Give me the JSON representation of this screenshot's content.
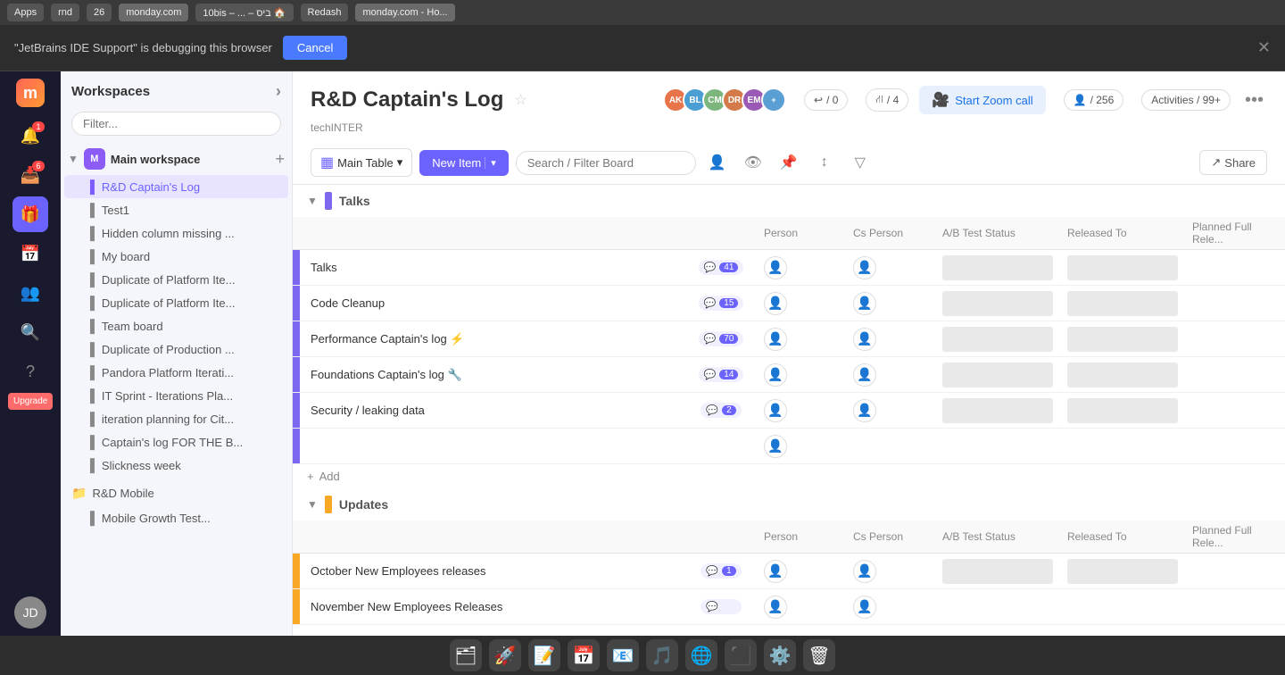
{
  "browser": {
    "tabs": [
      {
        "label": "Apps",
        "active": false
      },
      {
        "label": "rnd",
        "active": false
      },
      {
        "label": "26",
        "active": false
      },
      {
        "label": "monday.com",
        "active": false
      },
      {
        "label": "10bis – ... – ביס 🏠",
        "active": false
      },
      {
        "label": "Redash",
        "active": false
      },
      {
        "label": "monday.com - Ho...",
        "active": true
      }
    ]
  },
  "debug_bar": {
    "message": "\"JetBrains IDE Support\" is debugging this browser",
    "cancel_label": "Cancel",
    "close_icon": "✕"
  },
  "left_nav": {
    "logo": "m",
    "icons": [
      {
        "name": "bell-icon",
        "symbol": "🔔",
        "badge": "1"
      },
      {
        "name": "inbox-icon",
        "symbol": "📥",
        "badge": "6"
      },
      {
        "name": "gift-icon",
        "symbol": "🎁",
        "active": true
      },
      {
        "name": "calendar-icon",
        "symbol": "📅"
      },
      {
        "name": "people-icon",
        "symbol": "👥"
      },
      {
        "name": "search-icon",
        "symbol": "🔍"
      },
      {
        "name": "help-icon",
        "symbol": "?"
      }
    ],
    "upgrade_label": "Upgrade",
    "avatar_initials": "JD"
  },
  "sidebar": {
    "title": "Workspaces",
    "filter_placeholder": "Filter...",
    "workspace": {
      "name": "Main workspace",
      "icon": "M"
    },
    "items": [
      {
        "label": "R&D Captain's Log",
        "active": true
      },
      {
        "label": "Test1"
      },
      {
        "label": "Hidden column missing ..."
      },
      {
        "label": "My board"
      },
      {
        "label": "Duplicate of Platform Ite..."
      },
      {
        "label": "Duplicate of Platform Ite..."
      },
      {
        "label": "Team board"
      },
      {
        "label": "Duplicate of Production ..."
      },
      {
        "label": "Pandora Platform Iterati..."
      },
      {
        "label": "IT Sprint - Iterations Pla..."
      },
      {
        "label": "iteration planning for Cit..."
      },
      {
        "label": "Captain's log FOR THE B..."
      },
      {
        "label": "Slickness week"
      }
    ],
    "folder": {
      "name": "R&D Mobile"
    },
    "more_items": [
      {
        "label": "Mobile Growth Test..."
      }
    ]
  },
  "board": {
    "title": "R&D Captain's Log",
    "subtitle": "techINTER",
    "star_icon": "☆",
    "avatars": [
      {
        "color": "#e8744a",
        "initials": "AK"
      },
      {
        "color": "#4a9ed4",
        "initials": "BL"
      },
      {
        "color": "#7cb67c",
        "initials": "CM"
      },
      {
        "color": "#d47a4a",
        "initials": "DR"
      },
      {
        "color": "#9b59b6",
        "initials": "EM"
      }
    ],
    "stats": {
      "updates_count": "0",
      "members_count": "4",
      "activities_count": "99+",
      "person_count": "256"
    },
    "zoom_btn_label": "Start Zoom call",
    "more_icon": "•••",
    "table_name": "Main Table",
    "new_item_label": "New Item",
    "search_placeholder": "Search / Filter Board",
    "share_label": "Share",
    "columns": [
      "Person",
      "Cs Person",
      "A/B Test Status",
      "Released To",
      "Planned Full Rele..."
    ]
  },
  "groups": [
    {
      "name": "Talks",
      "color": "#7b68ee",
      "rows": [
        {
          "name": "Talks",
          "updates": "41"
        },
        {
          "name": "Code Cleanup",
          "updates": "15"
        },
        {
          "name": "Performance Captain's log ⚡",
          "updates": "70"
        },
        {
          "name": "Foundations Captain's log 🔧",
          "updates": "14"
        },
        {
          "name": "Security / leaking data",
          "updates": "2"
        }
      ]
    },
    {
      "name": "Updates",
      "color": "#f9a825",
      "rows": [
        {
          "name": "October New Employees releases",
          "updates": "1"
        },
        {
          "name": "November New Employees Releases",
          "updates": ""
        }
      ]
    }
  ]
}
